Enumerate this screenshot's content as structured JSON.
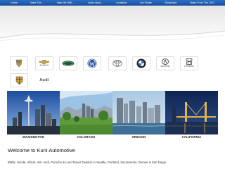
{
  "nav": {
    "items": [
      "Home",
      "Meet The ...",
      "Help Me With ...",
      "Learn Abou...",
      "Locations",
      "Car Finder",
      "Showroom",
      "Notes From The CEO"
    ]
  },
  "brands": [
    {
      "name": "Cadillac",
      "label": ""
    },
    {
      "name": "Chevrolet",
      "label": "CHEVY"
    },
    {
      "name": "Land Rover",
      "label": ""
    },
    {
      "name": "Volkswagen",
      "label": ""
    },
    {
      "name": "Toyota",
      "label": ""
    },
    {
      "name": "BMW",
      "label": ""
    },
    {
      "name": "Acura",
      "label": "ACURA"
    },
    {
      "name": "Honda",
      "label": "HONDA"
    },
    {
      "name": "Porsche",
      "label": ""
    },
    {
      "name": "Audi",
      "label": "Audi"
    }
  ],
  "cities": [
    {
      "caption": "WASHINGTON"
    },
    {
      "caption": "COLORADO"
    },
    {
      "caption": "OREGON"
    },
    {
      "caption": "CALIFORNIA"
    }
  ],
  "welcome": "Welcome to Kuni Automotive",
  "tagline": "BMW, Honda, Infiniti, VW, Audi, Porsche & Land Rover Dealers in Seattle, Portland, Sacramento, Denver & San Diego",
  "colors": {
    "nav_blue": "#1f5aa8",
    "page_bg": "#ffffff"
  }
}
